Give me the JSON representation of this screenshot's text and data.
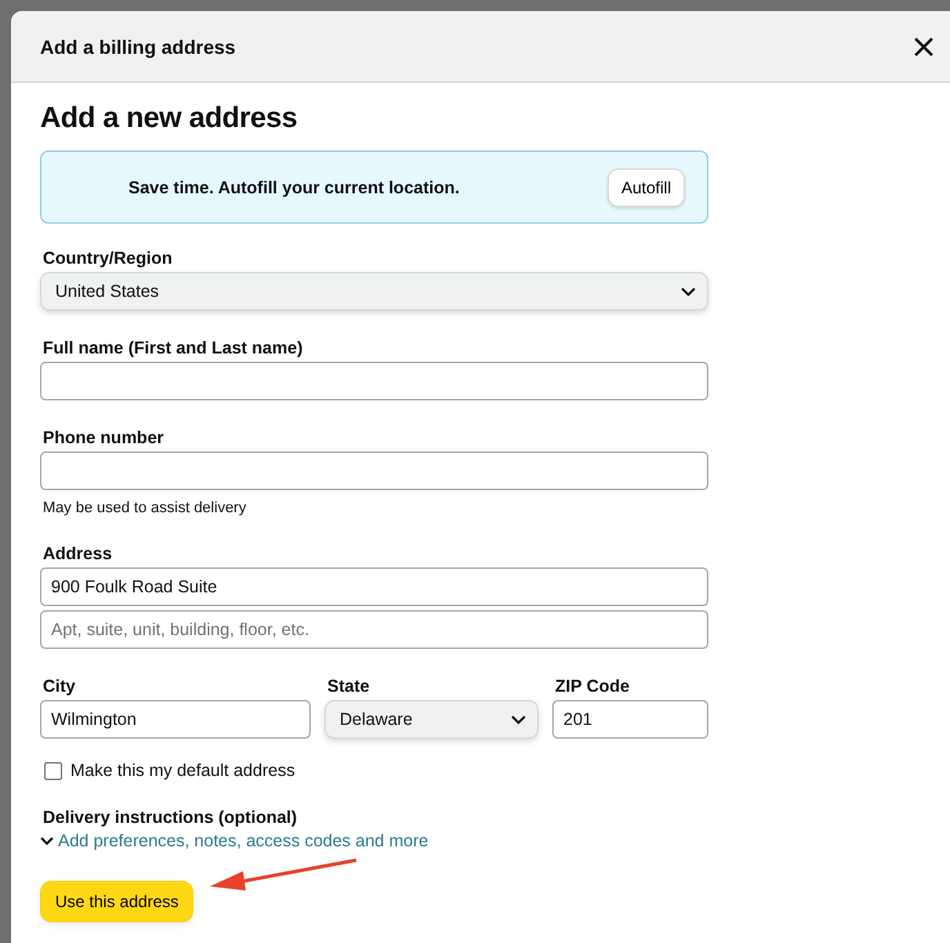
{
  "dialog": {
    "title": "Add a billing address"
  },
  "heading": "Add a new address",
  "autofill_banner": {
    "text": "Save time. Autofill your current location.",
    "button": "Autofill"
  },
  "fields": [
    {
      "kind": "select",
      "label": "Country/Region",
      "value": "United States"
    },
    {
      "kind": "text",
      "label": "Full name (First and Last name)"
    },
    {
      "kind": "text",
      "label": "Phone number",
      "hint": "May be used to assist delivery"
    },
    {
      "kind": "text",
      "label": "Address",
      "value": "900 Foulk Road Suite"
    },
    {
      "kind": "text",
      "placeholder": "Apt, suite, unit, building, floor, etc."
    }
  ],
  "city_row": [
    {
      "kind": "text",
      "label": "City",
      "value": "Wilmington"
    },
    {
      "kind": "select",
      "label": "State",
      "value": "Delaware"
    },
    {
      "kind": "text",
      "label": "ZIP Code",
      "value": "201"
    }
  ],
  "default_checkbox": {
    "label": "Make this my default address",
    "checked": false
  },
  "delivery": {
    "label": "Delivery instructions (optional)",
    "link": "Add preferences, notes, access codes and more",
    "expanded": false
  },
  "submit": "Use this address"
}
